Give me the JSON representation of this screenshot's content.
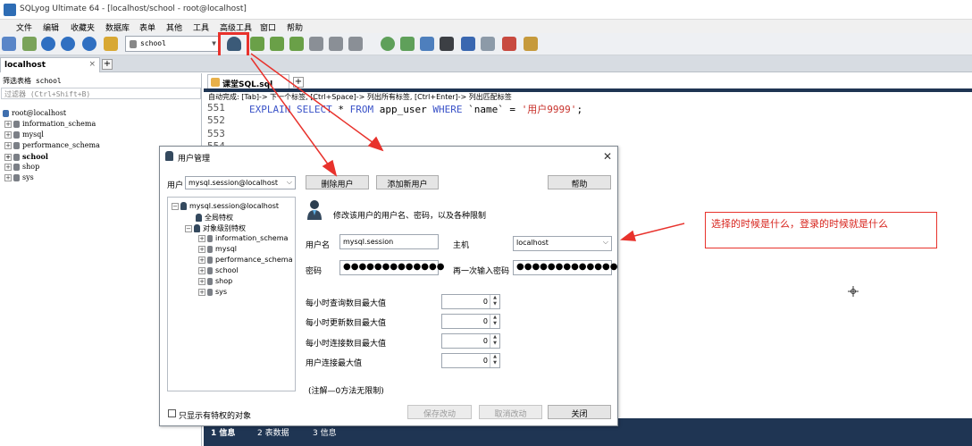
{
  "window": {
    "title": "SQLyog Ultimate 64 - [localhost/school - root@localhost]"
  },
  "menu": [
    "文件",
    "编辑",
    "收藏夹",
    "数据库",
    "表单",
    "其他",
    "工具",
    "高级工具",
    "窗口",
    "帮助"
  ],
  "toolbar": {
    "db_selector": "school"
  },
  "connection_tab": {
    "label": "localhost",
    "close": "×"
  },
  "left_panel": {
    "filter_label": "筛选表格 school",
    "filter_placeholder": "过滤器 (Ctrl+Shift+B)",
    "tree": [
      "root@localhost",
      "information_schema",
      "mysql",
      "performance_schema",
      "school",
      "shop",
      "sys"
    ]
  },
  "editor": {
    "tab_label": "课堂SQL.sql",
    "hint": "自动完成:  [Tab]-> 下一个标签, [Ctrl+Space]-> 列出所有标签, [Ctrl+Enter]-> 列出匹配标签",
    "line_numbers": [
      "551",
      "552",
      "553",
      "554"
    ],
    "code": {
      "kw1": "EXPLAIN SELECT",
      "star": " * ",
      "kw2": "FROM",
      "table": " app_user ",
      "kw3": "WHERE",
      "col": " `name` = ",
      "str": "'用户9999'",
      "end": ";"
    }
  },
  "bottom_tabs": [
    "1 信息",
    "2 表数据",
    "3 信息"
  ],
  "annotation": "选择的时候是什么，登录的时候就是什么",
  "dialog": {
    "title": "用户管理",
    "user_label": "用户",
    "user_value": "mysql.session@localhost",
    "delete_button": "删除用户",
    "add_button": "添加新用户",
    "help_button": "帮助",
    "description": "修改该用户的用户名、密码，以及各种限制",
    "tree": {
      "user": "mysql.session@localhost",
      "global": "全局特权",
      "object": "对象级别特权",
      "dbs": [
        "information_schema",
        "mysql",
        "performance_schema",
        "school",
        "shop",
        "sys"
      ]
    },
    "username_label": "用户名",
    "username_value": "mysql.session",
    "host_label": "主机",
    "host_value": "localhost",
    "password_label": "密码",
    "password_value": "●●●●●●●●●●●●●",
    "password2_label": "再一次输入密码",
    "password2_value": "●●●●●●●●●●●●●",
    "limits": [
      {
        "label": "每小时查询数目最大值",
        "value": "0"
      },
      {
        "label": "每小时更新数目最大值",
        "value": "0"
      },
      {
        "label": "每小时连接数目最大值",
        "value": "0"
      },
      {
        "label": "用户连接最大值",
        "value": "0"
      }
    ],
    "note": "(注解—0方法无限制)",
    "only_objects_checkbox": "只显示有特权的对象",
    "save_button": "保存改动",
    "cancel_button": "取消改动",
    "close_button": "关闭"
  },
  "colors": {
    "accent_red": "#e8322c",
    "editor_dark": "#1f3553",
    "keyword_blue": "#3b53c8"
  }
}
